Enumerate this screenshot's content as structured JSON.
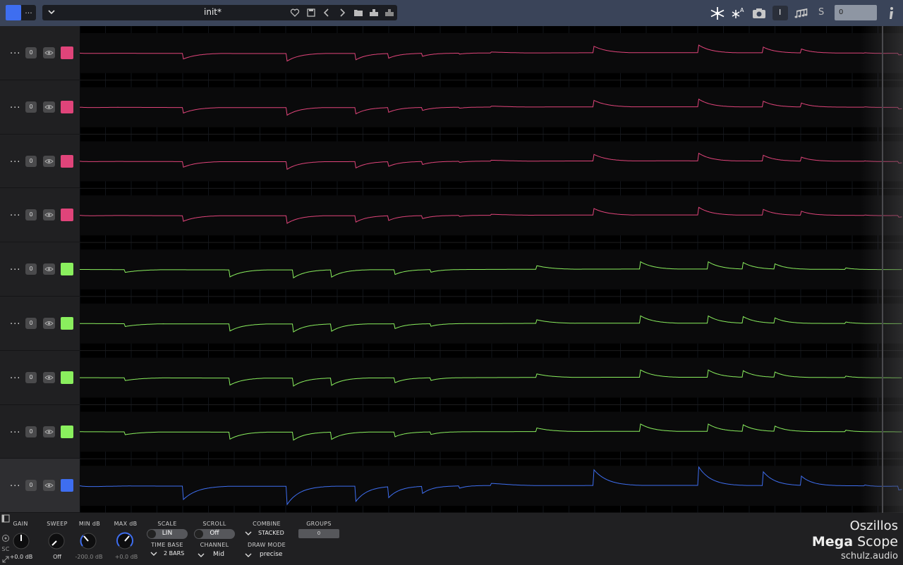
{
  "header": {
    "menu_label": "...",
    "preset_name": "init*",
    "sync_value": "0",
    "s_label": "S",
    "i_label": "I"
  },
  "channels": [
    {
      "number": "0",
      "color": "#e0447a",
      "menu": "...",
      "selected": false
    },
    {
      "number": "0",
      "color": "#e0447a",
      "menu": "...",
      "selected": false
    },
    {
      "number": "0",
      "color": "#e0447a",
      "menu": "...",
      "selected": false
    },
    {
      "number": "0",
      "color": "#e0447a",
      "menu": "...",
      "selected": false
    },
    {
      "number": "0",
      "color": "#8aef5e",
      "menu": "...",
      "selected": false
    },
    {
      "number": "0",
      "color": "#8aef5e",
      "menu": "...",
      "selected": false
    },
    {
      "number": "0",
      "color": "#8aef5e",
      "menu": "...",
      "selected": false
    },
    {
      "number": "0",
      "color": "#8aef5e",
      "menu": "...",
      "selected": false
    },
    {
      "number": "0",
      "color": "#3e6ef0",
      "menu": "...",
      "selected": true
    }
  ],
  "controls": {
    "gain": {
      "label": "GAIN",
      "value": "+0.0 dB"
    },
    "sweep": {
      "label": "SWEEP",
      "value": "Off"
    },
    "min_db": {
      "label": "MIN dB",
      "value": "-200.0 dB"
    },
    "max_db": {
      "label": "MAX dB",
      "value": "+0.0 dB"
    },
    "scale": {
      "label": "SCALE",
      "value": "LIN"
    },
    "scroll": {
      "label": "SCROLL",
      "value": "Off"
    },
    "combine": {
      "label": "COMBINE",
      "value": "STACKED"
    },
    "groups": {
      "label": "GROUPS",
      "value": "0"
    },
    "time_base": {
      "label": "TIME BASE",
      "value": "2 BARS"
    },
    "channel": {
      "label": "CHANNEL",
      "value": "Mid"
    },
    "draw_mode": {
      "label": "DRAW MODE",
      "value": "precise"
    },
    "sc_label": "SC"
  },
  "brand": {
    "line1": "Oszillos",
    "line2_bold": "Mega",
    "line2_rest": " Scope",
    "line3": "schulz.audio"
  },
  "colors": {
    "pink": "#e0447a",
    "green": "#8aef5e",
    "blue": "#3e6ef0",
    "topbar": "#3a4459"
  }
}
